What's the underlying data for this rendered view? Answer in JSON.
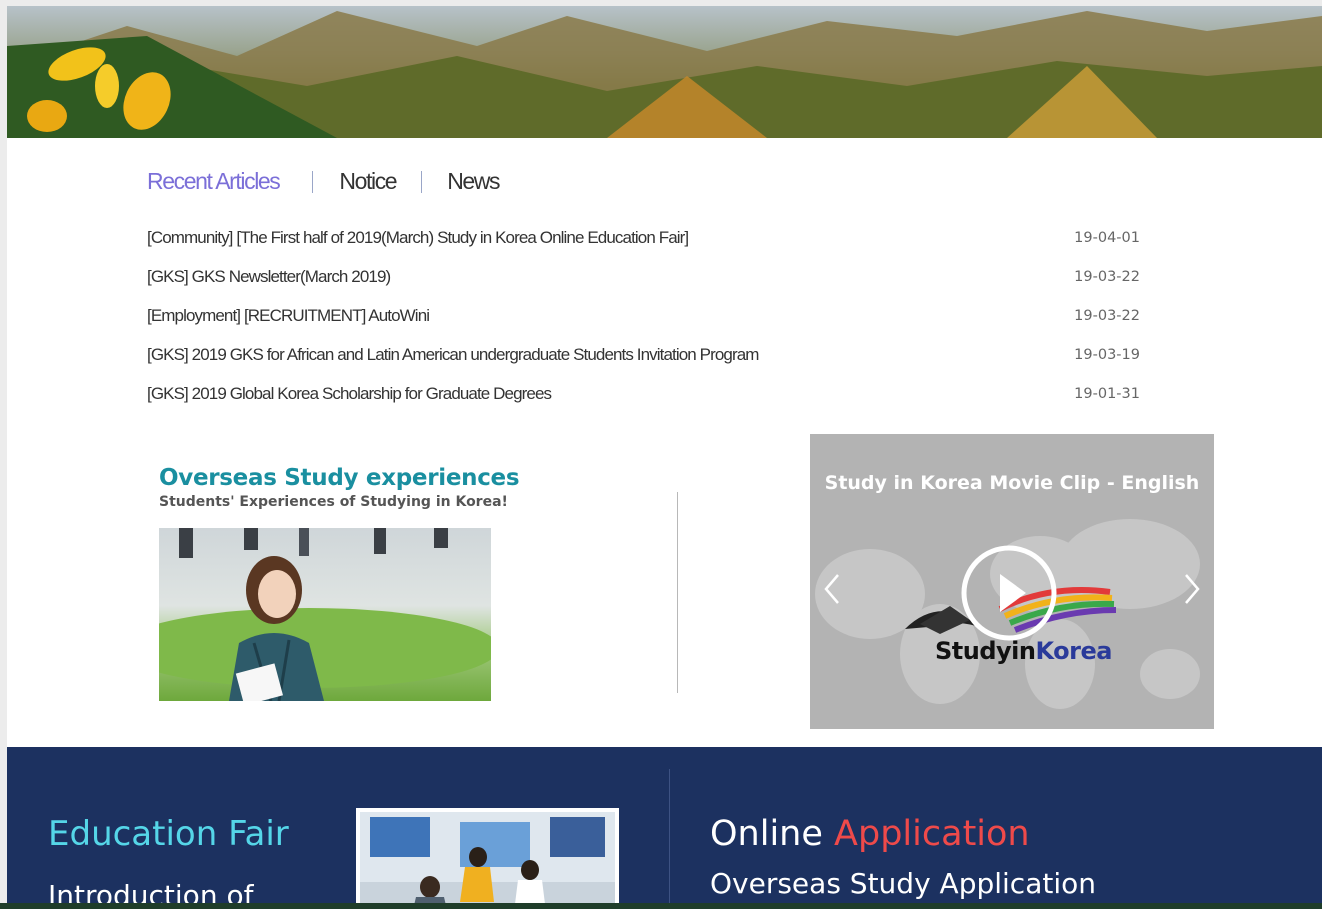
{
  "tabs": [
    {
      "label": "Recent Articles",
      "active": true
    },
    {
      "label": "Notice",
      "active": false
    },
    {
      "label": "News",
      "active": false
    }
  ],
  "articles": [
    {
      "title": "[Community] [The First half of 2019(March) Study in Korea Online Education Fair]",
      "date": "19-04-01"
    },
    {
      "title": "[GKS] GKS Newsletter(March 2019)",
      "date": "19-03-22"
    },
    {
      "title": "[Employment] [RECRUITMENT] AutoWini",
      "date": "19-03-22"
    },
    {
      "title": "[GKS] 2019 GKS for African and Latin American undergraduate Students Invitation Program",
      "date": "19-03-19"
    },
    {
      "title": "[GKS] 2019 Global Korea Scholarship for Graduate Degrees",
      "date": "19-01-31"
    }
  ],
  "overseas": {
    "title": "Overseas Study experiences",
    "subtitle": "Students' Experiences of Studying in Korea!"
  },
  "video": {
    "title": "Study in Korea Movie Clip - English",
    "brand_study": "Studyin",
    "brand_korea": "Korea"
  },
  "bottom": {
    "edu_title": "Education Fair",
    "edu_subtitle": "Introduction of",
    "online_word": "Online",
    "application_word": "Application",
    "online_subtitle": "Overseas Study Application"
  },
  "colors": {
    "accent_tab": "#7b6fd8",
    "overseas_title": "#1a8fa0",
    "navy_band": "#1c3160",
    "edu_title": "#55d6e8",
    "application_red": "#ee4a4a"
  }
}
